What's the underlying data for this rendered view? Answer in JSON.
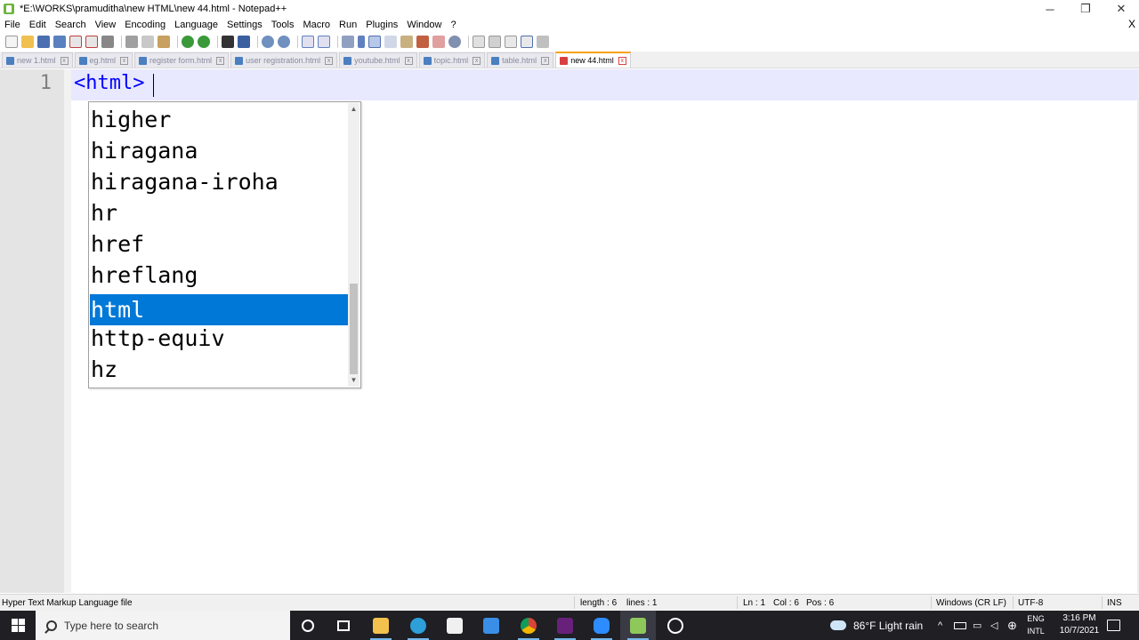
{
  "window": {
    "title": "*E:\\WORKS\\pramuditha\\new HTML\\new 44.html - Notepad++",
    "minimize_glyph": "─",
    "restore_glyph": "❐",
    "close_glyph": "✕"
  },
  "menu": {
    "items": [
      "File",
      "Edit",
      "Search",
      "View",
      "Encoding",
      "Language",
      "Settings",
      "Tools",
      "Macro",
      "Run",
      "Plugins",
      "Window",
      "?"
    ],
    "close_glyph": "X"
  },
  "toolbar": {
    "icons": [
      "new-file",
      "open-file",
      "save",
      "save-all",
      "close",
      "close-all",
      "print",
      "cut",
      "copy",
      "paste",
      "undo",
      "redo",
      "find",
      "replace",
      "zoom-in",
      "zoom-out",
      "sync-vertical",
      "sync-horizontal",
      "word-wrap",
      "show-all-chars",
      "indent-guide",
      "user-defined-lang",
      "doc-map",
      "function-list",
      "folder-as-workspace",
      "monitoring",
      "record-macro",
      "stop-record",
      "play-macro",
      "run-macro-multiple",
      "save-macro"
    ]
  },
  "tabs": [
    {
      "label": "new 1.html",
      "active": false
    },
    {
      "label": "eg.html",
      "active": false
    },
    {
      "label": "register form.html",
      "active": false
    },
    {
      "label": "user registration.html",
      "active": false
    },
    {
      "label": "youtube.html",
      "active": false
    },
    {
      "label": "topic.html",
      "active": false
    },
    {
      "label": "table.html",
      "active": false
    },
    {
      "label": "new 44.html",
      "active": true
    }
  ],
  "tab_close_glyph": "x",
  "editor": {
    "line_number": "1",
    "code_text": "<html>"
  },
  "autocomplete": {
    "items": [
      "higher",
      "hiragana",
      "hiragana-iroha",
      "hr",
      "href",
      "hreflang",
      "html",
      "http-equiv",
      "hz"
    ],
    "selected": "html",
    "scroll_up_glyph": "▲",
    "scroll_down_glyph": "▼"
  },
  "statusbar": {
    "file_type": "Hyper Text Markup Language file",
    "length": "length : 6",
    "lines": "lines : 1",
    "ln": "Ln : 1",
    "col": "Col : 6",
    "pos": "Pos : 6",
    "eol": "Windows (CR LF)",
    "encoding": "UTF-8",
    "mode": "INS"
  },
  "taskbar": {
    "search_placeholder": "Type here to search",
    "apps": [
      "cortana",
      "task-view",
      "file-explorer",
      "edge",
      "store",
      "mail",
      "chrome",
      "visual-studio",
      "zoom",
      "notepad-plus-plus",
      "obs"
    ],
    "weather": "86°F  Light rain",
    "lang_line1": "ENG",
    "lang_line2": "INTL",
    "time": "3:16 PM",
    "date": "10/7/2021"
  },
  "colors": {
    "selection": "#0078d7",
    "tag_text": "#0000ff",
    "current_line": "#e8e8ff",
    "active_tab_accent": "#f9a21c",
    "taskbar": "#1f1f24"
  }
}
